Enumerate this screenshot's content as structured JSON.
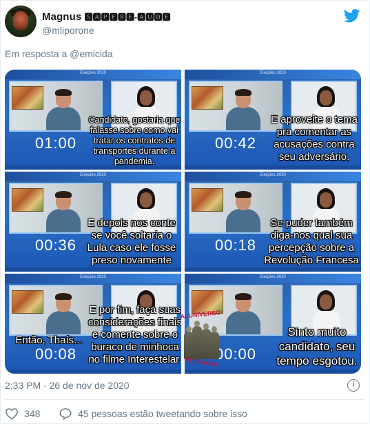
{
  "tweet": {
    "author_name": "Magnus",
    "author_tag": "🆂🅰🅿🅴🆁🅴-🅰🆄🅳🅴",
    "handle": "@mliporone",
    "reply_prefix": "Em resposta a",
    "reply_to": "@emicida",
    "timestamp": "2:33 PM · 26 de nov de 2020",
    "likes": "348",
    "comments_text": "45 pessoas estão tweetando sobre isso"
  },
  "icons": {
    "twitter": "twitter-bird-icon",
    "heart": "heart-icon",
    "comment": "comment-bubble-icon",
    "info": "info-icon"
  },
  "colors": {
    "twitter_blue": "#1da1f2",
    "muted": "#657786",
    "tile_blue": "#2a6fc6"
  },
  "media": {
    "tiles": [
      {
        "timer": "01:00",
        "caption": "Candidato, gostaria que falasse sobre como vai tratar os contratos de transportes durante a pandemia."
      },
      {
        "timer": "00:42",
        "caption": "E aproveite o tema pra comentar as acusações contra seu adversário."
      },
      {
        "timer": "00:36",
        "caption": "E depois nos conte se você soltaria o Lula caso ele fosse preso novamente"
      },
      {
        "timer": "00:18",
        "caption": "Se puder também diga-nos qual sua percepção sobre a Revolução Francesa"
      },
      {
        "timer": "00:08",
        "caption": "E por fim, faça suas considerações finais e comente sobre o buraco de minhoca no filme Interestelar.",
        "left_caption": "Então, Thaís..."
      },
      {
        "timer": "00:00",
        "caption": "Sinto muito candidato, seu tempo esgotou."
      }
    ],
    "small_label": "Eleições 2020",
    "watermark_top": "ALUNIVERSO",
    "watermark_bottom": "NERDSKULL"
  }
}
